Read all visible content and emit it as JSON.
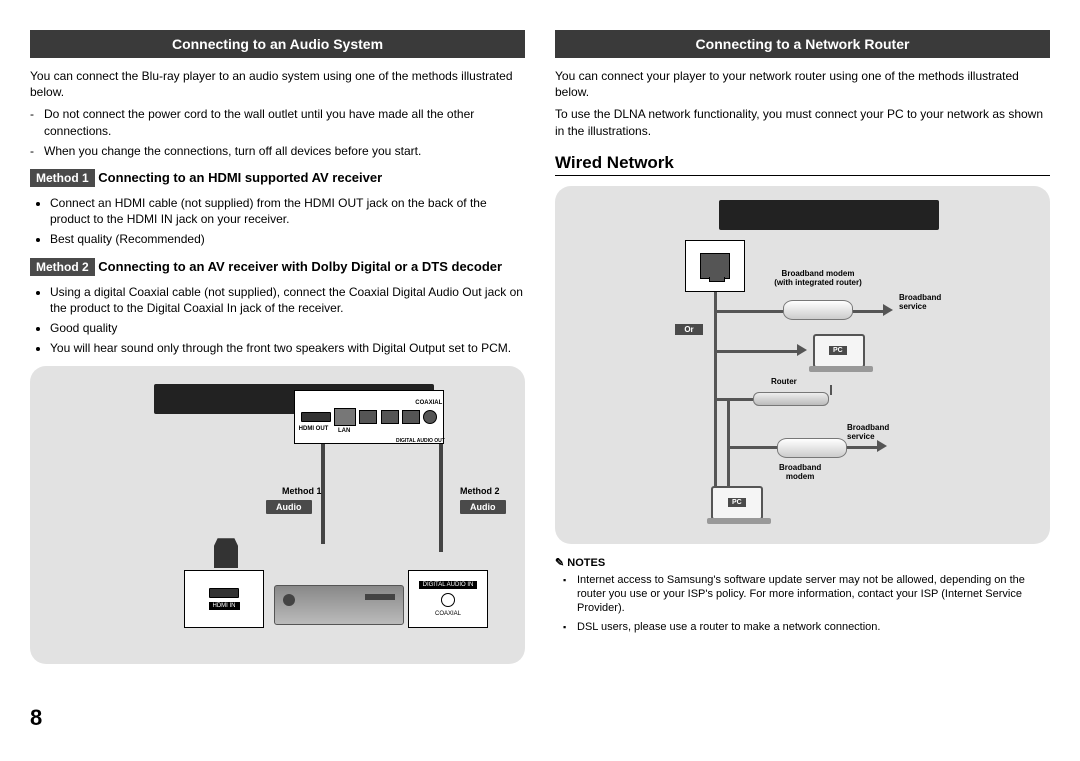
{
  "page_number": "8",
  "left": {
    "header": "Connecting to an Audio System",
    "intro": "You can connect the Blu-ray player to an audio system using one of the methods illustrated below.",
    "warnings": [
      "Do not connect the power cord to the wall outlet until you have made all the other connections.",
      "When you change the connections, turn off all devices before you start."
    ],
    "method1": {
      "pill": "Method 1",
      "title": "Connecting to an HDMI supported AV receiver",
      "points": [
        "Connect an HDMI cable (not supplied) from the HDMI OUT jack on the back of the product to the HDMI IN jack on your receiver.",
        "Best quality (Recommended)"
      ]
    },
    "method2": {
      "pill": "Method 2",
      "title": "Connecting to an AV receiver with Dolby Digital or a DTS decoder",
      "points": [
        "Using a digital Coaxial cable (not supplied), connect the Coaxial Digital Audio Out jack on the product to the Digital Coaxial In jack of the receiver.",
        "Good quality",
        "You will hear sound only through the front two speakers with Digital Output set to PCM."
      ]
    },
    "diagram": {
      "method1_lbl": "Method 1",
      "method2_lbl": "Method 2",
      "audio_lbl": "Audio",
      "hdmi_out": "HDMI OUT",
      "lan": "LAN",
      "digital_audio_out": "DIGITAL AUDIO OUT",
      "coaxial": "COAXIAL",
      "hdmi_in": "HDMI IN",
      "digital_audio_in": "DIGITAL AUDIO IN"
    }
  },
  "right": {
    "header": "Connecting to a Network Router",
    "intro1": "You can connect your player to your network router using one of the methods illustrated below.",
    "intro2": "To use the DLNA network functionality, you must connect your PC to your network as shown in the illustrations.",
    "subheading": "Wired Network",
    "diagram": {
      "or": "Or",
      "broadband_modem_int": "Broadband modem\n(with integrated router)",
      "broadband_service": "Broadband\nservice",
      "pc": "PC",
      "router": "Router",
      "broadband_modem": "Broadband\nmodem"
    },
    "notes_head": "NOTES",
    "notes": [
      "Internet access to Samsung's software update server may not be allowed, depending on the router you use or your ISP's policy. For more information, contact your ISP (Internet Service Provider).",
      "DSL users, please use a router to make a network connection."
    ]
  }
}
